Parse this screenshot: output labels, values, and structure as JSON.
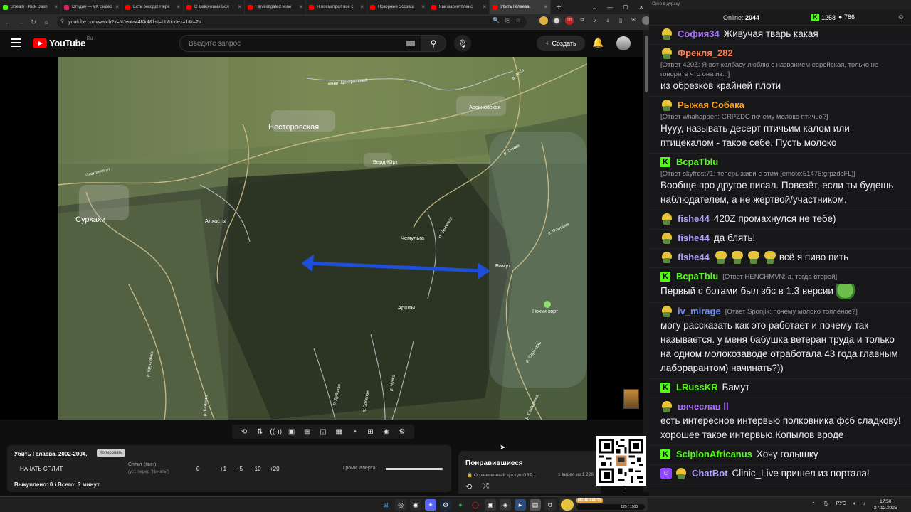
{
  "browser": {
    "tabs": [
      {
        "label": "Stream - Kick Dash",
        "color": "#53fc18",
        "active": false
      },
      {
        "label": "Студия — VK Видео",
        "color": "#e0245e",
        "active": false
      },
      {
        "label": "Есть рекорд! Пере",
        "color": "#ff0000",
        "active": false
      },
      {
        "label": "С Девочками Бол",
        "color": "#ff0000",
        "active": false
      },
      {
        "label": "I Investigated Mine",
        "color": "#ff0000",
        "active": false
      },
      {
        "label": "Я посмотрел все с",
        "color": "#ff0000",
        "active": false
      },
      {
        "label": "Позорные Зоозащ",
        "color": "#ff0000",
        "active": false
      },
      {
        "label": "Как маркетплейс",
        "color": "#ff0000",
        "active": false
      },
      {
        "label": "Убить Гелаева.",
        "color": "#ff0000",
        "active": true
      }
    ],
    "new_tab": "+",
    "url": "youtube.com/watch?v=NJeota44Kk4&list=LL&index=1&t=2s",
    "ext_badge": "685"
  },
  "youtube": {
    "logo_text": "YouTube",
    "region": "RU",
    "search_placeholder": "Введите запрос",
    "create_label": "Создать"
  },
  "map": {
    "labels": {
      "surkhakhi": "Сурхахи",
      "nesterovskaya": "Нестеровская",
      "assinovskaya": "Ассиновская",
      "berd_yurt": "Берд-Юрт",
      "alkhasty": "Алхасты",
      "chemulga": "Чемульга",
      "bamut": "Бамут",
      "arshty": "Аршты",
      "nokhchi_kort": "Нохчи-корт",
      "kanal": "канал Центральный",
      "sovkhoznaya": "Совхозная ул",
      "r_eruslanka": "р. Ерусланка",
      "r_sunzha": "р. Сунжа",
      "r_chemulga": "р. Чемульга",
      "r_assa": "р. Асса",
      "r_fortanga": "р. Фортанга",
      "r_dubovaya": "р. Дубовая",
      "r_chuchka": "р. Чучка",
      "r_solenaya": "р. Соленая",
      "r_sarkhsh": "р. Сарх-Шхь",
      "r_kalinka": "р. Калинка",
      "r_sakhalinka": "р. Сахалинка"
    },
    "arrow_color": "#1f4fd8"
  },
  "stream_overlay": {
    "split": {
      "title": "Убить Гелаева. 2002-2004.",
      "badge": "Копировать",
      "start_label": "НАЧАТЬ СПЛИТ",
      "split_label": "Сплит (мин):",
      "split_hint": "(уст. перед \"Начать\")",
      "values": [
        "0",
        "+1",
        "+5",
        "+10",
        "+20"
      ],
      "alert_label": "Громк. алерта:",
      "bought": "Выкуплено: 0 / Всего: ? минут"
    },
    "liked": {
      "title": "Понравившиеся",
      "subtitle": "🔒 Ограниченный доступ GRP...",
      "count": "1 видео из 1 226"
    }
  },
  "chat": {
    "window_title": "Окно в дураку",
    "online_label": "Online:",
    "online_value": "2044",
    "kick_count": "1258",
    "coin_count": "786",
    "messages": [
      {
        "badge": "pepe",
        "name": "София34",
        "color": "#a970ff",
        "reply": "",
        "text": "Живучая тварь какая"
      },
      {
        "badge": "pepe",
        "name": "Фрекля_282",
        "color": "#ff7f50",
        "reply": "[Ответ 420Z: Я вот колбасу люблю с названием еврейская, только не говорите что она из...]",
        "text": "из обрезков крайней плоти"
      },
      {
        "badge": "pepe",
        "name": "Рыжая Собака",
        "color": "#ff9f1a",
        "reply": "[Ответ whahappen: GRPZDC почему молоко птичье?]",
        "text": "Нууу, называть десерт птичьим калом или птицекалом - такое себе. Пусть молоко"
      },
      {
        "badge": "k",
        "name": "ВсраТblu",
        "color": "#53fc18",
        "reply": "[Ответ skyfrost71: теперь живи с этим [emote:51476:grpzdcFL]]",
        "text": "Вообще про другое писал. Повезёт, если ты будешь наблюдателем, а не жертвой/участником."
      },
      {
        "badge": "pepe",
        "name": "fishe44",
        "color": "#b4a0ff",
        "reply": "",
        "text": "420Z промахнулся не тебе)"
      },
      {
        "badge": "pepe",
        "name": "fishe44",
        "color": "#b4a0ff",
        "reply": "",
        "text": "да блять!"
      },
      {
        "badge": "pepe",
        "name": "fishe44",
        "color": "#b4a0ff",
        "reply": "",
        "text": "всё я пиво пить"
      },
      {
        "badge": "k",
        "name": "ВсраТblu",
        "color": "#53fc18",
        "reply": "[Ответ HENCHMVN: а, тогда второй]",
        "text": "Первый с ботами был збс в 1.3 версии"
      },
      {
        "badge": "pepe",
        "name": "iv_mirage",
        "color": "#6f8cff",
        "reply": "[Ответ Sponjik: почему молоко топлёное?]",
        "text": "могу рассказать как это работает и почему так называется. у меня бабушка ветеран труда и только на одном молокозаводе отработала 43 года главным лаборарантом) начинать?))"
      },
      {
        "badge": "k",
        "name": "LRussKR",
        "color": "#53fc18",
        "reply": "",
        "text": "Бамут"
      },
      {
        "badge": "pepe",
        "name": "вячеслав ll",
        "color": "#a970ff",
        "reply": "",
        "text": "есть интересное интервью полковника фсб сладкову! хорошее такое интервью.Копылов вроде"
      },
      {
        "badge": "k",
        "name": "ScipionAfricanus",
        "color": "#53fc18",
        "reply": "",
        "text": "Хочу голышку"
      },
      {
        "badge": "bot",
        "name": "ChatBot",
        "color": "#b4a0ff",
        "reply": "",
        "text": "Clinic_Live пришел из портала!"
      }
    ]
  },
  "taskbar": {
    "memes_tag": "MEME PARTY",
    "memes_value": "125 / 1500",
    "lang": "РУС",
    "time": "17:50",
    "date": "27.12.2025"
  }
}
